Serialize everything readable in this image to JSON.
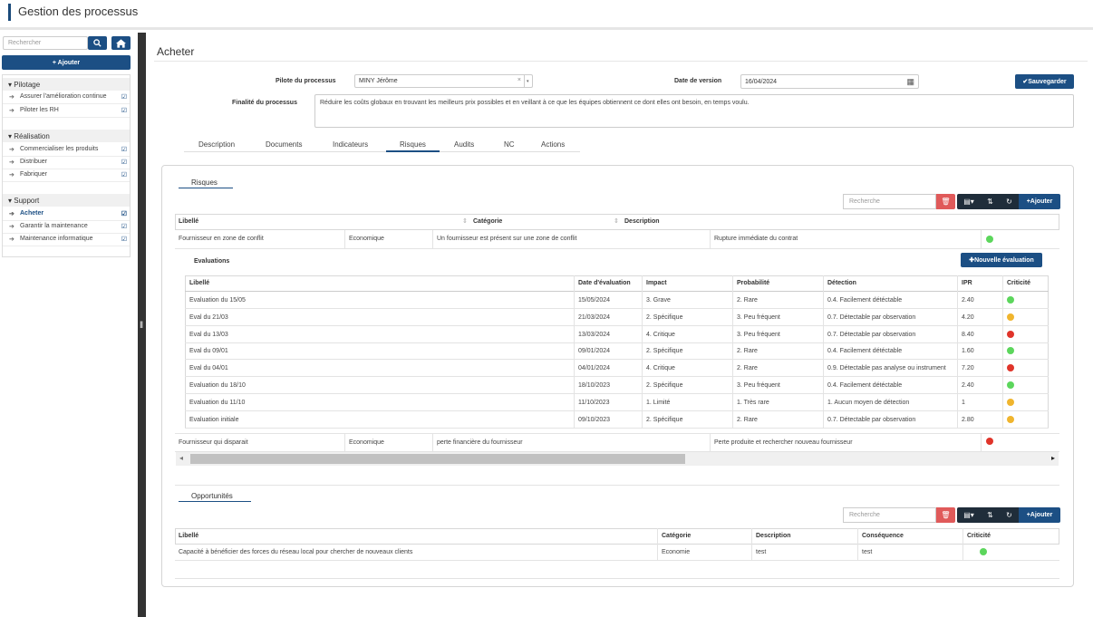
{
  "app": {
    "title": "Gestion des processus"
  },
  "sidebar": {
    "search_placeholder": "Rechercher",
    "add_label": "+ Ajouter",
    "groups": [
      {
        "label": "Pilotage",
        "items": [
          "Assurer l'amélioration continue",
          "Piloter les RH"
        ]
      },
      {
        "label": "Réalisation",
        "items": [
          "Commercialiser les produits",
          "Distribuer",
          "Fabriquer"
        ]
      },
      {
        "label": "Support",
        "items": [
          "Acheter",
          "Garantir la maintenance",
          "Maintenance informatique"
        ]
      }
    ]
  },
  "page": {
    "title": "Acheter",
    "pilot_label": "Pilote du processus",
    "pilot_value": "MINY Jérôme",
    "version_label": "Date de version",
    "version_value": "16/04/2024",
    "save_label": "Sauvegarder",
    "finalite_label": "Finalité du processus",
    "finalite_value": "Réduire les coûts globaux en trouvant les meilleurs prix possibles et en veillant à ce que les équipes obtiennent ce dont elles ont besoin, en temps voulu.",
    "tabs": [
      "Description",
      "Documents",
      "Indicateurs",
      "Risques",
      "Audits",
      "NC",
      "Actions"
    ],
    "active_tab": "Risques"
  },
  "risques": {
    "section_title": "Risques",
    "search_placeholder": "Recherche",
    "add_label": "Ajouter",
    "headers": [
      "Libellé",
      "Catégorie",
      "Description"
    ],
    "rows": [
      {
        "libelle": "Fournisseur en zone de conflit",
        "categorie": "Economique",
        "description": "Un fournisseur est présent sur une zone de conflit",
        "consequence": "Rupture immédiate du contrat",
        "color": "#5cd65c"
      },
      {
        "libelle": "Fournisseur qui disparait",
        "categorie": "Economique",
        "description": "perte financière du fournisseur",
        "consequence": "Perte produite et rechercher nouveau fournisseur",
        "color": "#e0342a"
      }
    ]
  },
  "evaluations": {
    "title": "Evaluations",
    "new_label": "Nouvelle évaluation",
    "headers": [
      "Libellé",
      "Date d'évaluation",
      "Impact",
      "Probabilité",
      "Détection",
      "IPR",
      "Criticité"
    ],
    "rows": [
      {
        "libelle": "Evaluation du 15/05",
        "date": "15/05/2024",
        "impact": "3. Grave",
        "proba": "2. Rare",
        "detection": "0.4. Facilement détéctable",
        "ipr": "2.40",
        "color": "#5cd65c"
      },
      {
        "libelle": "Eval du 21/03",
        "date": "21/03/2024",
        "impact": "2. Spécifique",
        "proba": "3. Peu fréquent",
        "detection": "0.7. Détectable par observation",
        "ipr": "4.20",
        "color": "#f0b52e"
      },
      {
        "libelle": "Eval du 13/03",
        "date": "13/03/2024",
        "impact": "4. Critique",
        "proba": "3. Peu fréquent",
        "detection": "0.7. Détectable par observation",
        "ipr": "8.40",
        "color": "#e0342a"
      },
      {
        "libelle": "Eval du 09/01",
        "date": "09/01/2024",
        "impact": "2. Spécifique",
        "proba": "2. Rare",
        "detection": "0.4. Facilement détéctable",
        "ipr": "1.60",
        "color": "#5cd65c"
      },
      {
        "libelle": "Eval du 04/01",
        "date": "04/01/2024",
        "impact": "4. Critique",
        "proba": "2. Rare",
        "detection": "0.9. Détectable pas analyse ou instrument",
        "ipr": "7.20",
        "color": "#e0342a"
      },
      {
        "libelle": "Evaluation du 18/10",
        "date": "18/10/2023",
        "impact": "2. Spécifique",
        "proba": "3. Peu fréquent",
        "detection": "0.4. Facilement détéctable",
        "ipr": "2.40",
        "color": "#5cd65c"
      },
      {
        "libelle": "Evaluation du 11/10",
        "date": "11/10/2023",
        "impact": "1. Limité",
        "proba": "1. Très rare",
        "detection": "1. Aucun moyen de détection",
        "ipr": "1",
        "color": "#f0b52e"
      },
      {
        "libelle": "Evaluation initiale",
        "date": "09/10/2023",
        "impact": "2. Spécifique",
        "proba": "2. Rare",
        "detection": "0.7. Détectable par observation",
        "ipr": "2.80",
        "color": "#f0b52e"
      }
    ]
  },
  "opportunites": {
    "section_title": "Opportunités",
    "search_placeholder": "Recherche",
    "add_label": "Ajouter",
    "headers": [
      "Libellé",
      "Catégorie",
      "Description",
      "Conséquence",
      "Criticité"
    ],
    "rows": [
      {
        "libelle": "Capacité à bénéficier des forces du réseau local pour chercher de nouveaux clients",
        "categorie": "Economie",
        "description": "test",
        "consequence": "test",
        "color": "#5cd65c"
      }
    ]
  }
}
